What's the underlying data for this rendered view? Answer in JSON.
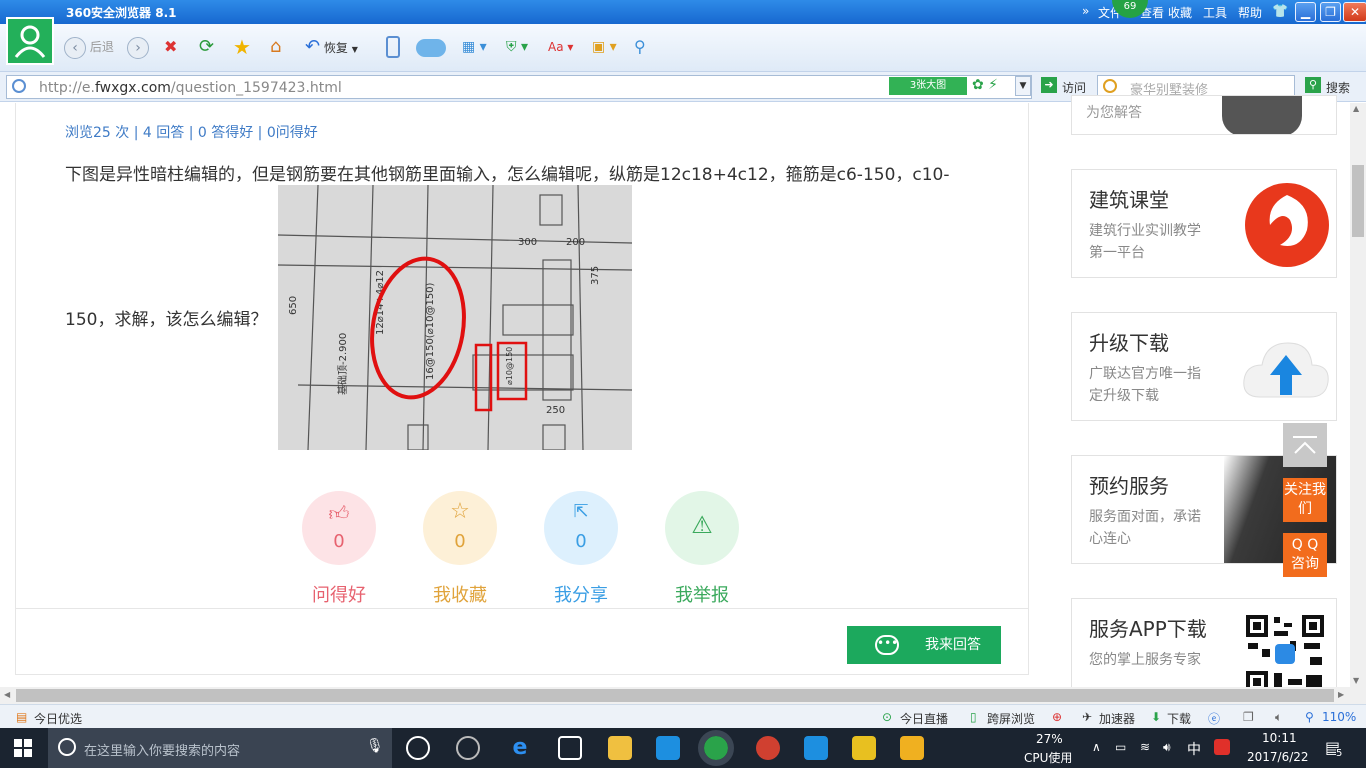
{
  "browser": {
    "title": "360安全浏览器 8.1",
    "menu": [
      "文件",
      "查看",
      "收藏",
      "工具",
      "帮助"
    ],
    "badge": "69",
    "toolbar": {
      "back": "后退",
      "restore": "恢复"
    },
    "url_prefix": "http://e.",
    "url_domain": "fwxgx.com",
    "url_path": "/question_1597423.html",
    "bigpic_label": "3张大图",
    "go_label": "访问",
    "search_placeholder": "豪华别墅装修",
    "search_button": "搜索"
  },
  "question": {
    "stats": "浏览25 次 | 4 回答 | 0 答得好 | 0问得好",
    "text_line1": "下图是异性暗柱编辑的，但是钢筋要在其他钢筋里面输入，怎么编辑呢，纵筋是12c18+4c12，箍筋是c6-150，c10-",
    "text_line2": "150，求解，该怎么编辑？",
    "image_labels": {
      "main_rebar": "12⌀14+4⌀12",
      "stirrup": "16@150(⌀10@150)",
      "elev": "基础顶-2.900",
      "dim300": "300",
      "dim200": "200",
      "dim250": "250",
      "dim375": "375",
      "dim650": "650",
      "extra": "⌀10@150"
    }
  },
  "actions": [
    {
      "count": "0",
      "label": "问得好",
      "color": "#e7626f",
      "bg": "#fde3e6",
      "icon": "thumbs-up-icon"
    },
    {
      "count": "0",
      "label": "我收藏",
      "color": "#e0a33b",
      "bg": "#fdf0d7",
      "icon": "star-icon"
    },
    {
      "count": "0",
      "label": "我分享",
      "color": "#3a9ee4",
      "bg": "#ddf0fd",
      "icon": "share-icon"
    },
    {
      "count": "",
      "label": "我举报",
      "color": "#3aa95c",
      "bg": "#e2f6e7",
      "icon": "warning-icon"
    }
  ],
  "answer_button": "我来回答",
  "sidebar": {
    "top_partial": "为您解答",
    "cards": [
      {
        "title": "建筑课堂",
        "desc": "建筑行业实训教学第一平台",
        "icon": "flame-logo-icon"
      },
      {
        "title": "升级下载",
        "desc": "广联达官方唯一指定升级下载",
        "icon": "cloud-upload-icon"
      },
      {
        "title": "预约服务",
        "desc": "服务面对面，承诺心连心",
        "icon": "handshake-photo-icon"
      },
      {
        "title": "服务APP下载",
        "desc": "您的掌上服务专家",
        "icon": "qr-code-icon"
      }
    ],
    "follow": "关注我们",
    "qq": "Q Q 咨询"
  },
  "statusbar": {
    "left": "今日优选",
    "live": "今日直播",
    "screen": "跨屏浏览",
    "accelerator": "加速器",
    "download": "下载",
    "zoom": "110%"
  },
  "taskbar": {
    "search_placeholder": "在这里输入你要搜索的内容",
    "cpu_percent": "27%",
    "cpu_label": "CPU使用",
    "ime": "中",
    "time": "10:11",
    "date": "2017/6/22",
    "notifications": "5"
  }
}
